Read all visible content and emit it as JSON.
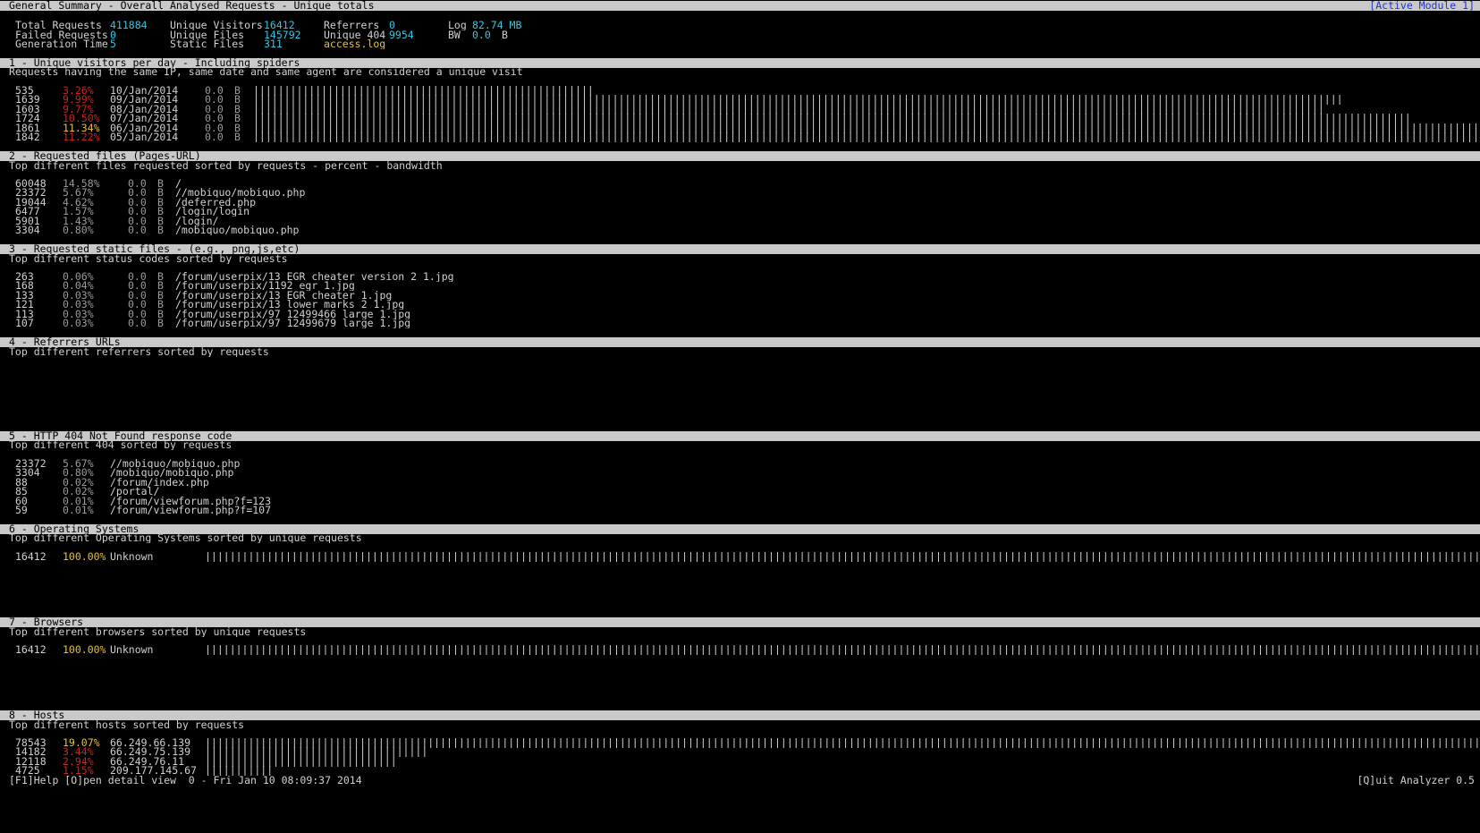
{
  "header": {
    "title": "General Summary - Overall Analysed Requests - Unique totals",
    "active_module": "[Active Module 1]"
  },
  "summary": {
    "total_requests_label": "Total Requests",
    "total_requests": "411884",
    "failed_requests_label": "Failed Requests",
    "failed_requests": "0",
    "generation_time_label": "Generation Time",
    "generation_time": "5",
    "unique_visitors_label": "Unique Visitors",
    "unique_visitors": "16412",
    "unique_files_label": "Unique Files",
    "unique_files": "145792",
    "static_files_label": "Static Files",
    "static_files": "311",
    "referrers_label": "Referrers",
    "referrers": "0",
    "unique404_label": "Unique 404",
    "unique404": "9954",
    "log_file": "access.log",
    "log_label": "Log",
    "log_size": "82.74 MB",
    "bw_label": "BW",
    "bw_value": "0.0",
    "bw_unit": "B"
  },
  "modules": {
    "m1": {
      "title": "1 - Unique visitors per day - Including spiders",
      "subtitle": "Requests having the same IP, same date and same agent are considered a unique visit",
      "rows": [
        {
          "hits": "535",
          "pct": "3.26%",
          "pct_color": "red",
          "date": "10/Jan/2014",
          "bw": "0.0",
          "unit": "B",
          "bar": "|||||||||||||||||||||||||||||||||||||||||||||||||||||||"
        },
        {
          "hits": "1639",
          "pct": "9.99%",
          "pct_color": "red",
          "date": "09/Jan/2014",
          "bw": "0.0",
          "unit": "B",
          "bar": "||||||||||||||||||||||||||||||||||||||||||||||||||||||||||||||||||||||||||||||||||||||||||||||||||||||||||||||||||||||||||||||||||||||||||||||||||||||||||||||||||||||||||||||||"
        },
        {
          "hits": "1603",
          "pct": "9.77%",
          "pct_color": "red",
          "date": "08/Jan/2014",
          "bw": "0.0",
          "unit": "B",
          "bar": "|||||||||||||||||||||||||||||||||||||||||||||||||||||||||||||||||||||||||||||||||||||||||||||||||||||||||||||||||||||||||||||||||||||||||||||||||||||||||||||||||||||||||||||"
        },
        {
          "hits": "1724",
          "pct": "10.50%",
          "pct_color": "red",
          "date": "07/Jan/2014",
          "bw": "0.0",
          "unit": "B",
          "bar": "|||||||||||||||||||||||||||||||||||||||||||||||||||||||||||||||||||||||||||||||||||||||||||||||||||||||||||||||||||||||||||||||||||||||||||||||||||||||||||||||||||||||||||||||||||||||||||"
        },
        {
          "hits": "1861",
          "pct": "11.34%",
          "pct_color": "yellow",
          "date": "06/Jan/2014",
          "bw": "0.0",
          "unit": "B",
          "bar": "|||||||||||||||||||||||||||||||||||||||||||||||||||||||||||||||||||||||||||||||||||||||||||||||||||||||||||||||||||||||||||||||||||||||||||||||||||||||||||||||||||||||||||||||||||||||||||||||||||||||||"
        },
        {
          "hits": "1842",
          "pct": "11.22%",
          "pct_color": "red",
          "date": "05/Jan/2014",
          "bw": "0.0",
          "unit": "B",
          "bar": "|||||||||||||||||||||||||||||||||||||||||||||||||||||||||||||||||||||||||||||||||||||||||||||||||||||||||||||||||||||||||||||||||||||||||||||||||||||||||||||||||||||||||||||||||||||||||||||||||||||||"
        }
      ]
    },
    "m2": {
      "title": "2 - Requested files (Pages-URL)",
      "subtitle": "Top different files requested sorted by requests - percent - bandwidth",
      "rows": [
        {
          "hits": "60048",
          "pct": "14.58%",
          "bw": "0.0",
          "unit": "B",
          "path": "/"
        },
        {
          "hits": "23372",
          "pct": "5.67%",
          "bw": "0.0",
          "unit": "B",
          "path": "//mobiquo/mobiquo.php"
        },
        {
          "hits": "19044",
          "pct": "4.62%",
          "bw": "0.0",
          "unit": "B",
          "path": "/deferred.php"
        },
        {
          "hits": "6477",
          "pct": "1.57%",
          "bw": "0.0",
          "unit": "B",
          "path": "/login/login"
        },
        {
          "hits": "5901",
          "pct": "1.43%",
          "bw": "0.0",
          "unit": "B",
          "path": "/login/"
        },
        {
          "hits": "3304",
          "pct": "0.80%",
          "bw": "0.0",
          "unit": "B",
          "path": "/mobiquo/mobiquo.php"
        }
      ]
    },
    "m3": {
      "title": "3 - Requested static files - (e.g., png,js,etc)",
      "subtitle": "Top different status codes sorted by requests",
      "rows": [
        {
          "hits": "263",
          "pct": "0.06%",
          "bw": "0.0",
          "unit": "B",
          "path": "/forum/userpix/13_EGR_cheater_version_2_1.jpg"
        },
        {
          "hits": "168",
          "pct": "0.04%",
          "bw": "0.0",
          "unit": "B",
          "path": "/forum/userpix/1192_egr_1.jpg"
        },
        {
          "hits": "133",
          "pct": "0.03%",
          "bw": "0.0",
          "unit": "B",
          "path": "/forum/userpix/13_EGR_cheater_1.jpg"
        },
        {
          "hits": "121",
          "pct": "0.03%",
          "bw": "0.0",
          "unit": "B",
          "path": "/forum/userpix/13_lower_marks_2_1.jpg"
        },
        {
          "hits": "113",
          "pct": "0.03%",
          "bw": "0.0",
          "unit": "B",
          "path": "/forum/userpix/97_12499466_large_1.jpg"
        },
        {
          "hits": "107",
          "pct": "0.03%",
          "bw": "0.0",
          "unit": "B",
          "path": "/forum/userpix/97_12499679_large_1.jpg"
        }
      ]
    },
    "m4": {
      "title": "4 - Referrers URLs",
      "subtitle": "Top different referrers sorted by requests"
    },
    "m5": {
      "title": "5 - HTTP 404 Not Found response code",
      "subtitle": "Top different 404 sorted by requests",
      "rows": [
        {
          "hits": "23372",
          "pct": "5.67%",
          "path": "//mobiquo/mobiquo.php"
        },
        {
          "hits": "3304",
          "pct": "0.80%",
          "path": "/mobiquo/mobiquo.php"
        },
        {
          "hits": "88",
          "pct": "0.02%",
          "path": "/forum/index.php"
        },
        {
          "hits": "85",
          "pct": "0.02%",
          "path": "/portal/"
        },
        {
          "hits": "60",
          "pct": "0.01%",
          "path": "/forum/viewforum.php?f=123"
        },
        {
          "hits": "59",
          "pct": "0.01%",
          "path": "/forum/viewforum.php?f=107"
        }
      ]
    },
    "m6": {
      "title": "6 - Operating Systems",
      "subtitle": "Top different Operating Systems sorted by unique requests",
      "rows": [
        {
          "hits": "16412",
          "pct": "100.00%",
          "name": "Unknown",
          "bar": "|||||||||||||||||||||||||||||||||||||||||||||||||||||||||||||||||||||||||||||||||||||||||||||||||||||||||||||||||||||||||||||||||||||||||||||||||||||||||||||||||||||||||||||||||||||||||||||||||||||||||||||||||||||||||||||||||"
        }
      ]
    },
    "m7": {
      "title": "7 - Browsers",
      "subtitle": "Top different browsers sorted by unique requests",
      "rows": [
        {
          "hits": "16412",
          "pct": "100.00%",
          "name": "Unknown",
          "bar": "|||||||||||||||||||||||||||||||||||||||||||||||||||||||||||||||||||||||||||||||||||||||||||||||||||||||||||||||||||||||||||||||||||||||||||||||||||||||||||||||||||||||||||||||||||||||||||||||||||||||||||||||||||||||||||||||||"
        }
      ]
    },
    "m8": {
      "title": "8 - Hosts",
      "subtitle": "Top different hosts sorted by requests",
      "rows": [
        {
          "hits": "78543",
          "pct": "19.07%",
          "pct_color": "yellow",
          "host": "66.249.66.139",
          "bar": "|||||||||||||||||||||||||||||||||||||||||||||||||||||||||||||||||||||||||||||||||||||||||||||||||||||||||||||||||||||||||||||||||||||||||||||||||||||||||||||||||||||||||||||||||||||||||||||||||||||||||||||||||||||||||||||||||"
        },
        {
          "hits": "14182",
          "pct": "3.44%",
          "pct_color": "red",
          "host": "66.249.75.139",
          "bar": "||||||||||||||||||||||||||||||||||||"
        },
        {
          "hits": "12118",
          "pct": "2.94%",
          "pct_color": "red",
          "host": "66.249.76.11",
          "bar": "|||||||||||||||||||||||||||||||"
        },
        {
          "hits": "4725",
          "pct": "1.15%",
          "pct_color": "red",
          "host": "209.177.145.67",
          "bar": "|||||||||||"
        }
      ]
    }
  },
  "footer": {
    "help": "[F1]Help [O]pen detail view  0 - Fri Jan 10 08:09:37 2014",
    "quit": "[Q]uit Analyzer 0.5"
  }
}
